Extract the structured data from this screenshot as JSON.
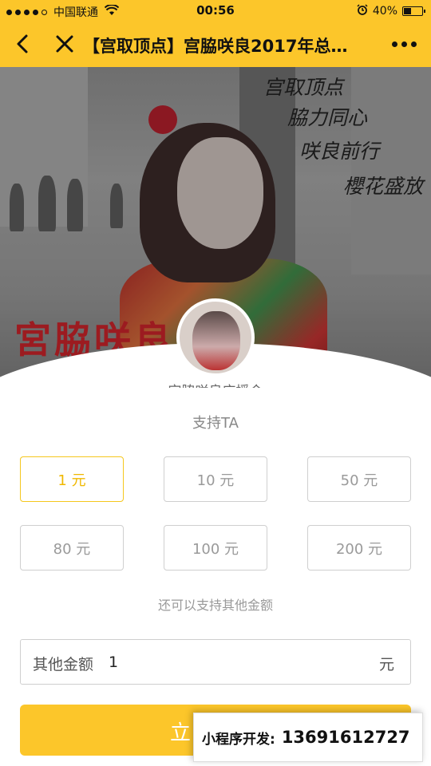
{
  "status_bar": {
    "carrier": "中国联通",
    "time": "00:56",
    "battery": "40%",
    "battery_level": 0.4
  },
  "nav": {
    "title": "【宫取顶点】宫脇咲良2017年总…"
  },
  "banner": {
    "slogan_lines": [
      "宫取顶点",
      "脇力同心",
      "咲良前行",
      "櫻花盛放"
    ],
    "name_overlay": "宮脇咲良"
  },
  "profile": {
    "name": "宫脇咲良应援会"
  },
  "support": {
    "title": "支持TA",
    "amounts": [
      "1 元",
      "10 元",
      "50 元",
      "80 元",
      "100 元",
      "200 元"
    ],
    "selected_index": 0,
    "hint": "还可以支持其他金额",
    "other_label": "其他金额",
    "other_value": "1",
    "other_unit": "元",
    "submit_label": "立"
  },
  "watermark": {
    "label": "小程序开发:",
    "phone": "13691612727"
  },
  "colors": {
    "brand_yellow": "#fcc62a",
    "selected_text": "#f0b800"
  }
}
